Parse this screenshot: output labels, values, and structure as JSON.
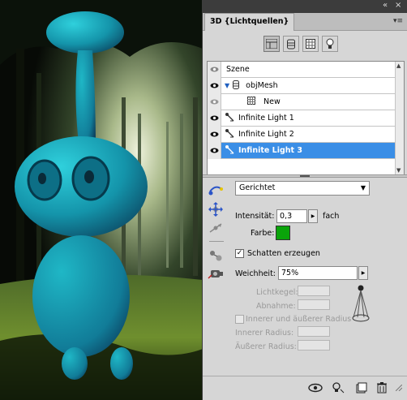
{
  "panel": {
    "tab_title": "3D {Lichtquellen}",
    "menu_icon": "panel-menu-icon",
    "filters": [
      {
        "name": "scene-filter-icon",
        "active": true
      },
      {
        "name": "mesh-filter-icon",
        "active": false
      },
      {
        "name": "material-filter-icon",
        "active": false
      },
      {
        "name": "light-filter-icon",
        "active": false
      }
    ]
  },
  "layers": [
    {
      "label": "Szene",
      "kind": "scene",
      "selected": false
    },
    {
      "label": "objMesh",
      "kind": "mesh",
      "selected": false
    },
    {
      "label": "New",
      "kind": "material",
      "selected": false
    },
    {
      "label": "Infinite Light 1",
      "kind": "light",
      "selected": false
    },
    {
      "label": "Infinite Light 2",
      "kind": "light",
      "selected": false
    },
    {
      "label": "Infinite Light 3",
      "kind": "light",
      "selected": true
    }
  ],
  "light": {
    "type_value": "Gerichtet",
    "intensity_label": "Intensität:",
    "intensity_value": "0,3",
    "intensity_unit": "fach",
    "color_label": "Farbe:",
    "color": "#0aa40a",
    "shadows_label": "Schatten erzeugen",
    "shadows_checked": true,
    "softness_label": "Weichheit:",
    "softness_value": "75%",
    "hotspot_label": "Lichtkegel:",
    "falloff_label": "Abnahme:",
    "radius_checkbox_label": "Innerer und äußerer Radius",
    "inner_radius_label": "Innerer Radius:",
    "outer_radius_label": "Äußerer Radius:"
  },
  "bottom_buttons": [
    "toggle-lights-icon",
    "new-light-icon",
    "render-icon",
    "delete-icon"
  ],
  "colors": {
    "panel_bg": "#d6d6d6",
    "selection": "#3a8ee6",
    "creature": "#12a0b4"
  }
}
